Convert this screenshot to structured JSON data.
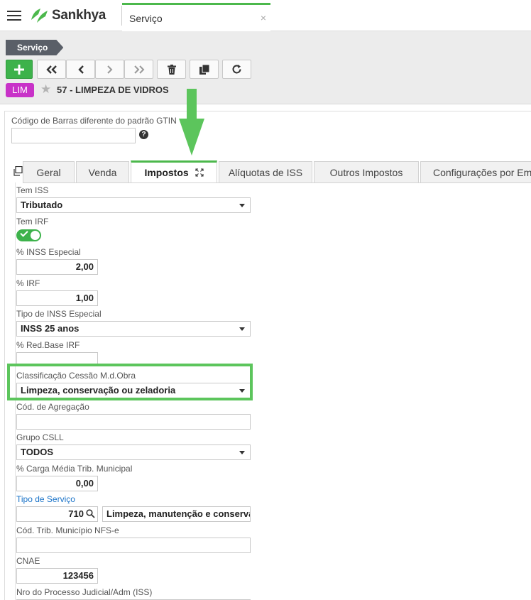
{
  "app": {
    "brand": "Sankhya",
    "tab": {
      "label": "Serviço",
      "close": "×"
    }
  },
  "header": {
    "breadcrumb": "Serviço",
    "toolbar": {
      "add": "plus-icon",
      "first": "double-chevron-left-icon",
      "prev": "chevron-left-icon",
      "next": "chevron-right-icon",
      "last": "double-chevron-right-icon",
      "delete": "trash-icon",
      "copy": "copy-icon",
      "refresh": "refresh-icon"
    },
    "badge": "LIM",
    "record_title": "57 - LIMPEZA DE VIDROS"
  },
  "form": {
    "barcode": {
      "label": "Código de Barras diferente do padrão GTIN",
      "value": "",
      "help": "?"
    },
    "tabs": [
      {
        "label": "Geral"
      },
      {
        "label": "Venda"
      },
      {
        "label": "Impostos",
        "active": true
      },
      {
        "label": "Alíquotas de ISS"
      },
      {
        "label": "Outros Impostos"
      },
      {
        "label": "Configurações por Em"
      }
    ],
    "tem_iss": {
      "label": "Tem ISS",
      "value": "Tributado"
    },
    "tem_irf": {
      "label": "Tem IRF",
      "value": true
    },
    "inss_especial": {
      "label": "% INSS Especial",
      "value": "2,00"
    },
    "irf": {
      "label": "% IRF",
      "value": "1,00"
    },
    "tipo_inss": {
      "label": "Tipo de INSS Especial",
      "value": "INSS 25 anos"
    },
    "red_base_irf": {
      "label": "% Red.Base IRF",
      "value": ""
    },
    "classificacao": {
      "label": "Classificação Cessão M.d.Obra",
      "value": "Limpeza, conservação ou zeladoria"
    },
    "cod_agregacao": {
      "label": "Cód. de Agregação",
      "value": ""
    },
    "grupo_csll": {
      "label": "Grupo CSLL",
      "value": "TODOS"
    },
    "carga_media": {
      "label": "% Carga Média Trib. Municipal",
      "value": "0,00"
    },
    "tipo_servico": {
      "label": "Tipo de Serviço",
      "code": "710",
      "description": "Limpeza, manutenção e conserva"
    },
    "cod_trib": {
      "label": "Cód. Trib. Município NFS-e",
      "value": ""
    },
    "cnae": {
      "label": "CNAE",
      "value": "123456"
    },
    "nro_processo": {
      "label": "Nro do Processo Judicial/Adm (ISS)"
    }
  },
  "colors": {
    "accent": "#4cb84c",
    "add_button": "#3db24b",
    "badge": "#c832c8",
    "breadcrumb": "#5a5f68",
    "link": "#1a73c8",
    "highlight": "#5cc55c"
  }
}
